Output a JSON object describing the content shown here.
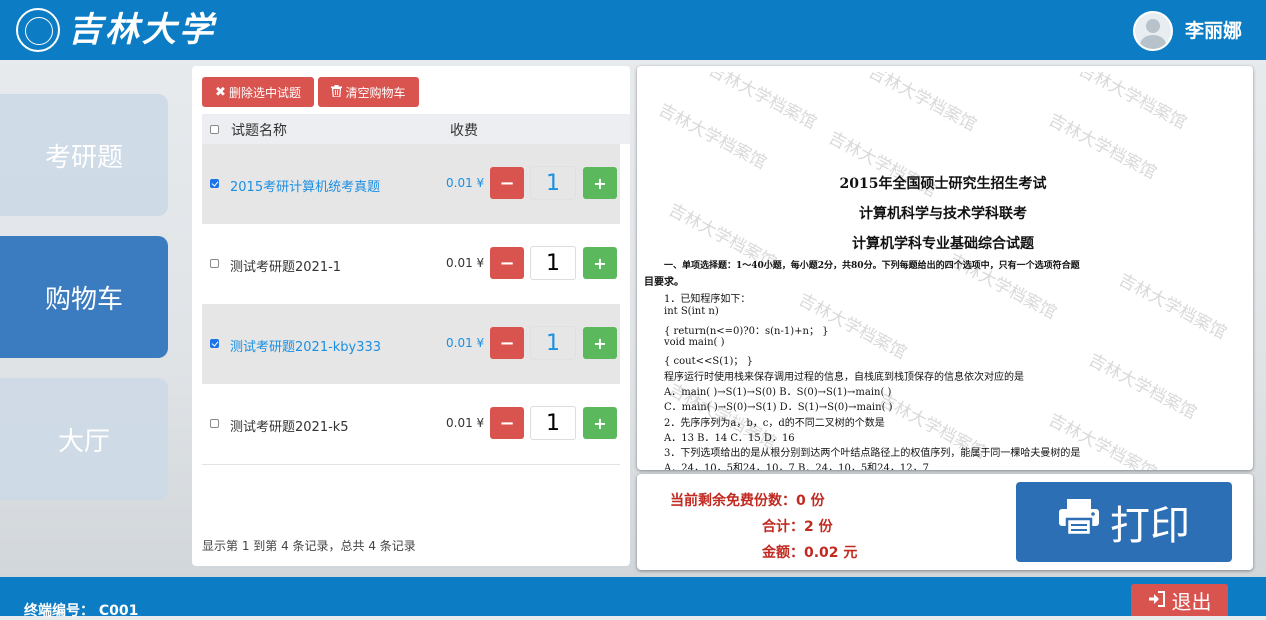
{
  "header": {
    "logo_text": "吉林大学",
    "user_name": "李丽娜"
  },
  "sidebar": {
    "items": [
      {
        "label": "考研题",
        "active": false
      },
      {
        "label": "购物车",
        "active": true
      },
      {
        "label": "大厅",
        "active": false
      }
    ]
  },
  "cart": {
    "delete_selected_label": "删除选中试题",
    "clear_cart_label": "清空购物车",
    "columns": [
      "试题名称",
      "收费"
    ],
    "rows": [
      {
        "name": "2015考研计算机统考真题",
        "price": "0.01 ¥",
        "qty": "1",
        "selected": true
      },
      {
        "name": "测试考研题2021-1",
        "price": "0.01 ¥",
        "qty": "1",
        "selected": false
      },
      {
        "name": "测试考研题2021-kby333",
        "price": "0.01 ¥",
        "qty": "1",
        "selected": true
      },
      {
        "name": "测试考研题2021-k5",
        "price": "0.01 ¥",
        "qty": "1",
        "selected": false
      }
    ],
    "pagination_text": "显示第 1 到第 4 条记录，总共 4 条记录"
  },
  "preview": {
    "watermark": "吉林大学档案馆",
    "title_1": "2015年全国硕士研究生招生考试",
    "title_2": "计算机科学与技术学科联考",
    "title_3": "计算机学科专业基础综合试题",
    "lines": [
      "一、单项选择题：1～40小题，每小题2分，共80分。下列每题给出的四个选项中，只有一个选项符合题",
      "目要求。",
      "1．已知程序如下：",
      "int S(int n)",
      "{      return(n<=0)?0：s(n-1)+n；          }",
      "void main(        )",
      "{      cout<<S(1)；        }",
      "程序运行时使用栈来保存调用过程的信息，自栈底到栈顶保存的信息依次对应的是",
      "A．main(   )→S(1)→S(0)                       B．S(0)→S(1)→main(   )",
      "C．main(   )→S(0)→S(1)                       D．S(1)→S(0)→main(   )",
      "2．先序序列为a，b，c，d的不同二叉树的个数是",
      "A．13                    B．14            C．15                D．16",
      "3．下列选项给出的是从根分别到达两个叶结点路径上的权值序列，能属于同一棵哈夫曼树的是",
      "A．24，10，5和24，10，7                      B．24，10，5和24，12，7"
    ]
  },
  "summary": {
    "free_label": "当前剩余免费份数：0  份",
    "total_label": "合计：2  份",
    "amount_label": "金额：0.02  元",
    "print_label": "打印"
  },
  "footer": {
    "terminal_label": "终端编号：  C001",
    "exit_label": "退出"
  }
}
